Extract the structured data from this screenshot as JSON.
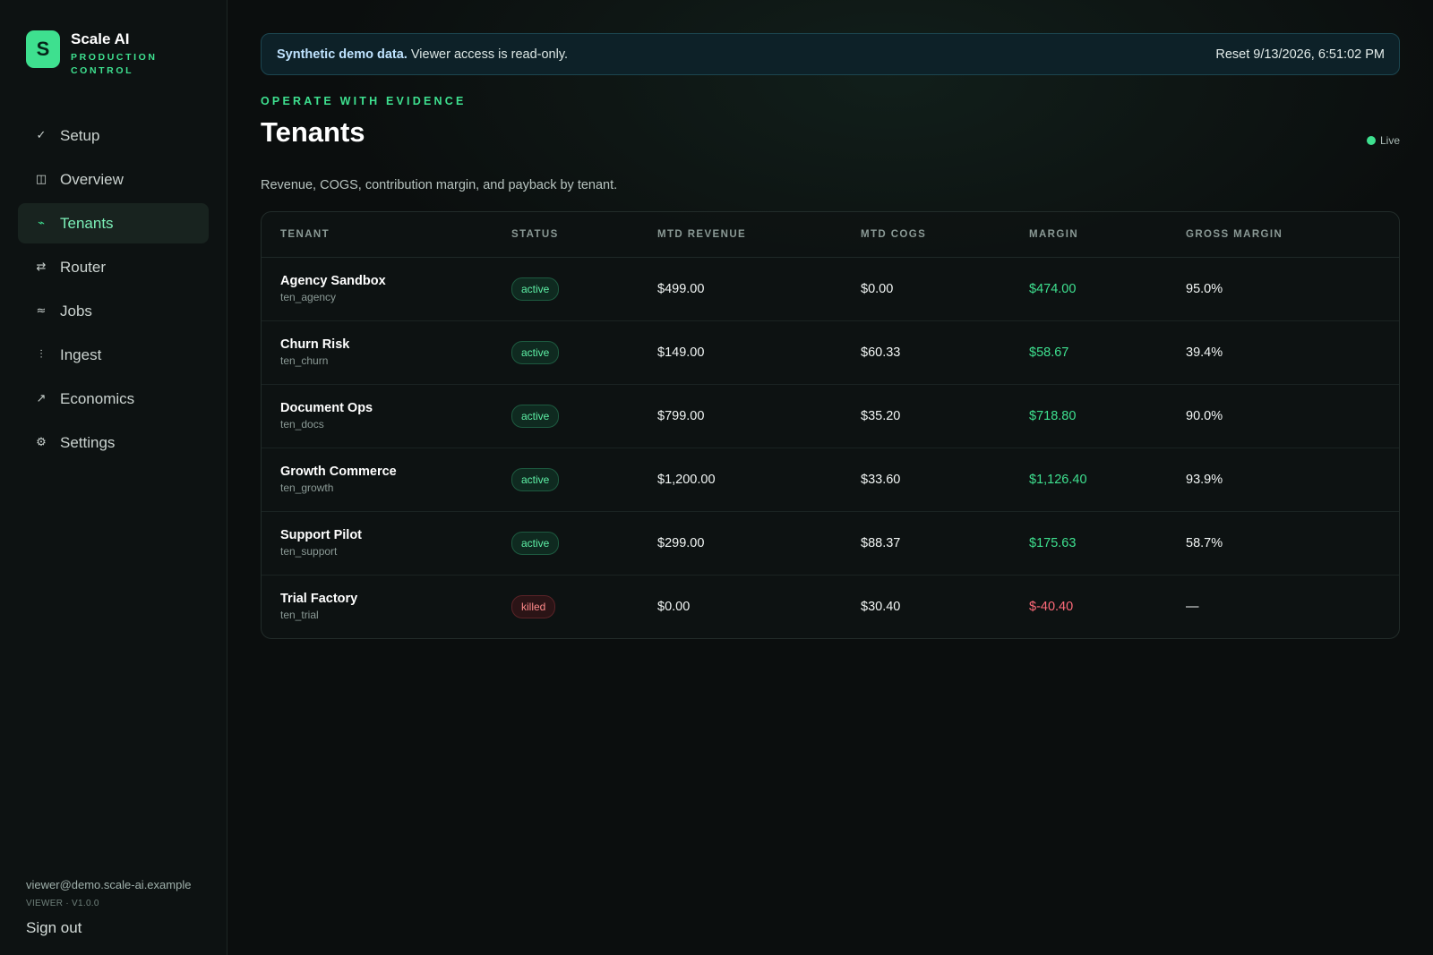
{
  "brand": {
    "mark": "S",
    "name": "Scale AI",
    "sub": "PRODUCTION CONTROL"
  },
  "nav": [
    {
      "label": "Setup",
      "icon": "check-icon",
      "glyph": "✓",
      "active": false
    },
    {
      "label": "Overview",
      "icon": "layout-icon",
      "glyph": "◫",
      "active": false
    },
    {
      "label": "Tenants",
      "icon": "tenants-icon",
      "glyph": "⌁",
      "active": true
    },
    {
      "label": "Router",
      "icon": "arrows-icon",
      "glyph": "⇄",
      "active": false
    },
    {
      "label": "Jobs",
      "icon": "jobs-icon",
      "glyph": "≈",
      "active": false
    },
    {
      "label": "Ingest",
      "icon": "ingest-icon",
      "glyph": "⫶",
      "active": false
    },
    {
      "label": "Economics",
      "icon": "trend-up-icon",
      "glyph": "↗",
      "active": false
    },
    {
      "label": "Settings",
      "icon": "gear-icon",
      "glyph": "⚙",
      "active": false
    }
  ],
  "footer": {
    "email": "viewer@demo.scale-ai.example",
    "meta": "VIEWER · V1.0.0",
    "sign_out": "Sign out"
  },
  "banner": {
    "strong": "Synthetic demo data.",
    "text": " Viewer access is read-only.",
    "reset": "Reset 9/13/2026, 6:51:02 PM"
  },
  "header": {
    "eyebrow": "OPERATE WITH EVIDENCE",
    "title": "Tenants",
    "live": "Live",
    "subtitle": "Revenue, COGS, contribution margin, and payback by tenant."
  },
  "table": {
    "columns": [
      "TENANT",
      "STATUS",
      "MTD REVENUE",
      "MTD COGS",
      "MARGIN",
      "GROSS MARGIN"
    ],
    "rows": [
      {
        "name": "Agency Sandbox",
        "id": "ten_agency",
        "status": "active",
        "revenue": "$499.00",
        "cogs": "$0.00",
        "margin": "$474.00",
        "margin_sign": "pos",
        "gross": "95.0%"
      },
      {
        "name": "Churn Risk",
        "id": "ten_churn",
        "status": "active",
        "revenue": "$149.00",
        "cogs": "$60.33",
        "margin": "$58.67",
        "margin_sign": "pos",
        "gross": "39.4%"
      },
      {
        "name": "Document Ops",
        "id": "ten_docs",
        "status": "active",
        "revenue": "$799.00",
        "cogs": "$35.20",
        "margin": "$718.80",
        "margin_sign": "pos",
        "gross": "90.0%"
      },
      {
        "name": "Growth Commerce",
        "id": "ten_growth",
        "status": "active",
        "revenue": "$1,200.00",
        "cogs": "$33.60",
        "margin": "$1,126.40",
        "margin_sign": "pos",
        "gross": "93.9%"
      },
      {
        "name": "Support Pilot",
        "id": "ten_support",
        "status": "active",
        "revenue": "$299.00",
        "cogs": "$88.37",
        "margin": "$175.63",
        "margin_sign": "pos",
        "gross": "58.7%"
      },
      {
        "name": "Trial Factory",
        "id": "ten_trial",
        "status": "killed",
        "revenue": "$0.00",
        "cogs": "$30.40",
        "margin": "$-40.40",
        "margin_sign": "neg",
        "gross": "—"
      }
    ]
  },
  "colors": {
    "accent": "#3ee08f",
    "negative": "#ff6b7a",
    "banner_bg": "#0d2128"
  }
}
